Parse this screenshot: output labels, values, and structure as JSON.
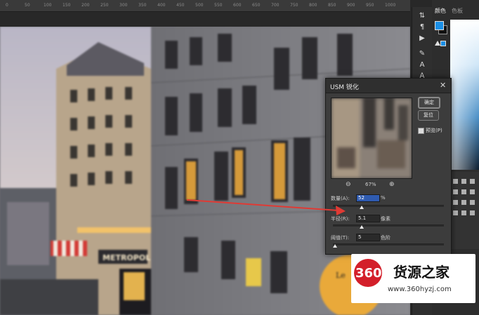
{
  "ruler": {
    "ticks": [
      "0",
      "50",
      "100",
      "150",
      "200",
      "250",
      "300",
      "350",
      "400",
      "450",
      "500",
      "550",
      "600",
      "650",
      "700",
      "750",
      "800",
      "850",
      "900",
      "950",
      "1000"
    ]
  },
  "panel": {
    "tab_color": "颜色",
    "tab_swatches": "色板",
    "foreground_color": "#1b8fe6",
    "background_color": "#111111"
  },
  "dialog": {
    "title": "USM 锐化",
    "ok_label": "确定",
    "reset_label": "复位",
    "preview_label": "预览(P)",
    "preview_checked": true,
    "zoom_value": "67%",
    "amount_label": "数量(A):",
    "amount_value": "52",
    "amount_unit": "%",
    "amount_fraction": 0.26,
    "radius_label": "半径(R):",
    "radius_value": "5.1",
    "radius_unit": "像素",
    "radius_fraction": 0.26,
    "threshold_label": "阈值(T):",
    "threshold_value": "5",
    "threshold_unit": "色阶",
    "threshold_fraction": 0.02
  },
  "canvas": {
    "sign_text": "METROPOL",
    "shop_sign": "Le"
  },
  "watermark": {
    "logo": "360",
    "title": "货源之家",
    "url": "www.360hyzj.com"
  },
  "icons": {
    "close": "close-icon",
    "zoom_out": "zoom-out-icon",
    "zoom_in": "zoom-in-icon"
  }
}
